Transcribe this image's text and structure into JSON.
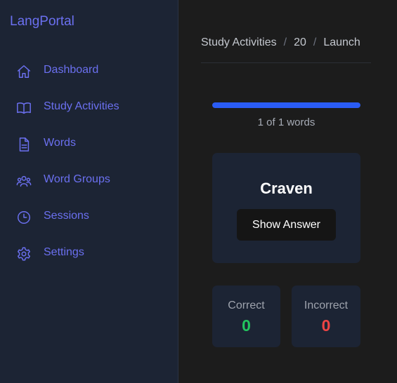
{
  "app": {
    "brand": "LangPortal"
  },
  "colors": {
    "accent": "#6b70f0",
    "progress": "#2a5cf5",
    "correct": "#22c55e",
    "incorrect": "#ef4444"
  },
  "sidebar": {
    "items": [
      {
        "label": "Dashboard",
        "icon": "home-icon"
      },
      {
        "label": "Study Activities",
        "icon": "book-open-icon"
      },
      {
        "label": "Words",
        "icon": "document-icon"
      },
      {
        "label": "Word Groups",
        "icon": "users-icon"
      },
      {
        "label": "Sessions",
        "icon": "clock-icon"
      },
      {
        "label": "Settings",
        "icon": "gear-icon"
      }
    ]
  },
  "breadcrumb": {
    "items": [
      "Study Activities",
      "20",
      "Launch"
    ],
    "separator": "/"
  },
  "progress": {
    "fraction": 1.0,
    "text": "1 of 1 words"
  },
  "flashcard": {
    "word": "Craven",
    "show_answer_label": "Show Answer"
  },
  "stats": {
    "correct": {
      "label": "Correct",
      "value": "0"
    },
    "incorrect": {
      "label": "Incorrect",
      "value": "0"
    }
  }
}
